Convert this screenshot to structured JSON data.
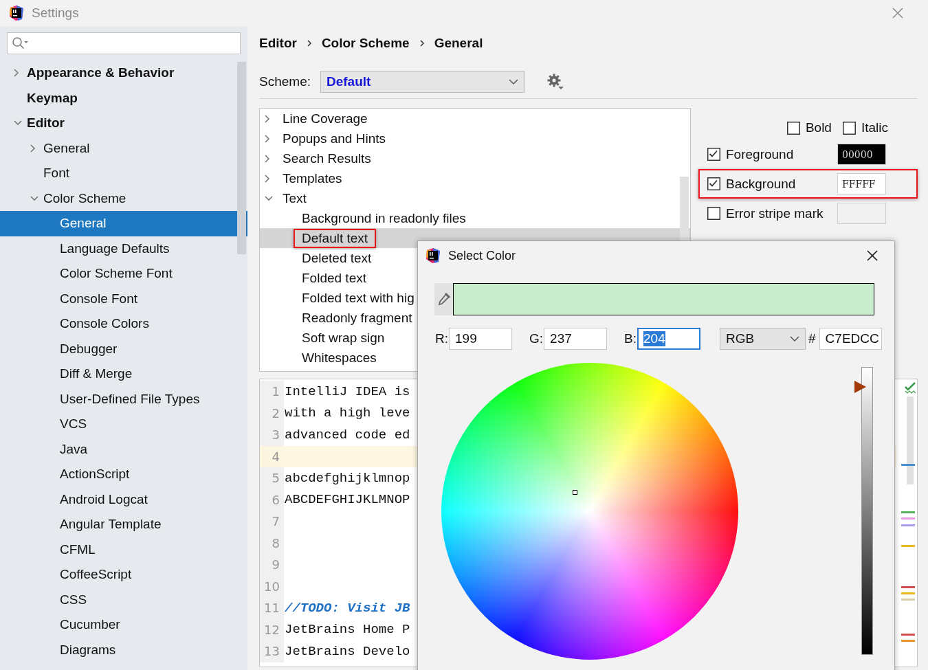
{
  "window": {
    "title": "Settings"
  },
  "sidebar": {
    "items": [
      {
        "label": "Appearance & Behavior",
        "expanded": false,
        "selected": false
      },
      {
        "label": "Keymap",
        "selected": false
      },
      {
        "label": "Editor",
        "expanded": true,
        "selected": false,
        "children": [
          {
            "label": "General",
            "expanded": false,
            "selected": false
          },
          {
            "label": "Font",
            "selected": false
          },
          {
            "label": "Color Scheme",
            "expanded": true,
            "selected": false,
            "children": [
              {
                "label": "General",
                "selected": true
              },
              {
                "label": "Language Defaults",
                "selected": false
              },
              {
                "label": "Color Scheme Font",
                "selected": false
              },
              {
                "label": "Console Font",
                "selected": false
              },
              {
                "label": "Console Colors",
                "selected": false
              },
              {
                "label": "Debugger",
                "selected": false
              },
              {
                "label": "Diff & Merge",
                "selected": false
              },
              {
                "label": "User-Defined File Types",
                "selected": false
              },
              {
                "label": "VCS",
                "selected": false
              },
              {
                "label": "Java",
                "selected": false
              },
              {
                "label": "ActionScript",
                "selected": false
              },
              {
                "label": "Android Logcat",
                "selected": false
              },
              {
                "label": "Angular Template",
                "selected": false
              },
              {
                "label": "CFML",
                "selected": false
              },
              {
                "label": "CoffeeScript",
                "selected": false
              },
              {
                "label": "CSS",
                "selected": false
              },
              {
                "label": "Cucumber",
                "selected": false
              },
              {
                "label": "Diagrams",
                "selected": false
              }
            ]
          }
        ]
      }
    ]
  },
  "breadcrumb": [
    "Editor",
    "Color Scheme",
    "General"
  ],
  "scheme": {
    "label": "Scheme:",
    "value": "Default"
  },
  "attributes_tree": [
    {
      "label": "Line Coverage",
      "expanded": false,
      "selected": false
    },
    {
      "label": "Popups and Hints",
      "expanded": false,
      "selected": false
    },
    {
      "label": "Search Results",
      "expanded": false,
      "selected": false
    },
    {
      "label": "Templates",
      "expanded": false,
      "selected": false
    },
    {
      "label": "Text",
      "expanded": true,
      "selected": false,
      "children": [
        {
          "label": "Background in readonly files",
          "selected": false,
          "annotated": false
        },
        {
          "label": "Default text",
          "selected": true,
          "annotated": true
        },
        {
          "label": "Deleted text",
          "selected": false,
          "annotated": false
        },
        {
          "label": "Folded text",
          "selected": false,
          "annotated": false
        },
        {
          "label": "Folded text with hig",
          "selected": false,
          "annotated": false
        },
        {
          "label": "Readonly fragment",
          "selected": false,
          "annotated": false
        },
        {
          "label": "Soft wrap sign",
          "selected": false,
          "annotated": false
        },
        {
          "label": "Whitespaces",
          "selected": false,
          "annotated": false
        }
      ]
    }
  ],
  "font_styles": [
    {
      "label": "Bold",
      "checked": false
    },
    {
      "label": "Italic",
      "checked": false
    }
  ],
  "attributes": [
    {
      "label": "Foreground",
      "checked": true,
      "value": "00000",
      "color": "#000000",
      "annotated": false
    },
    {
      "label": "Background",
      "checked": true,
      "value": "FFFFF",
      "color": "#ffffff",
      "annotated": true
    },
    {
      "label": "Error stripe mark",
      "checked": false,
      "annotated": false
    }
  ],
  "preview": {
    "lines": [
      {
        "number": "1",
        "text": "IntelliJ IDEA is",
        "kind": "plain",
        "current": false
      },
      {
        "number": "2",
        "text": "with a high leve",
        "kind": "plain",
        "current": false
      },
      {
        "number": "3",
        "text": "advanced code ed",
        "kind": "plain",
        "current": false
      },
      {
        "number": "4",
        "current": true
      },
      {
        "number": "5",
        "text": "abcdefghijklmnop",
        "kind": "plain",
        "current": false
      },
      {
        "number": "6",
        "text": "ABCDEFGHIJKLMNOP",
        "kind": "plain",
        "current": false
      },
      {
        "number": "7",
        "current": false
      },
      {
        "number": "8",
        "current": false
      },
      {
        "number": "9",
        "current": false
      },
      {
        "number": "10",
        "current": false
      },
      {
        "number": "11",
        "text": "//TODO: Visit JB",
        "kind": "todo",
        "current": false
      },
      {
        "number": "12",
        "text": "JetBrains Home P",
        "kind": "plain",
        "current": false
      },
      {
        "number": "13",
        "text": "JetBrains Develo",
        "kind": "plain",
        "current": false
      }
    ]
  },
  "color_dialog": {
    "title": "Select Color",
    "color": "#c7edcc",
    "fields": [
      {
        "label": "R:",
        "value": "199",
        "focused": false
      },
      {
        "label": "G:",
        "value": "237",
        "focused": false
      },
      {
        "label": "B:",
        "value": "204",
        "focused": true
      }
    ],
    "mode": "RGB",
    "hex_label": "#",
    "hex": "C7EDCC",
    "brightness": {
      "level": 0.93
    }
  }
}
